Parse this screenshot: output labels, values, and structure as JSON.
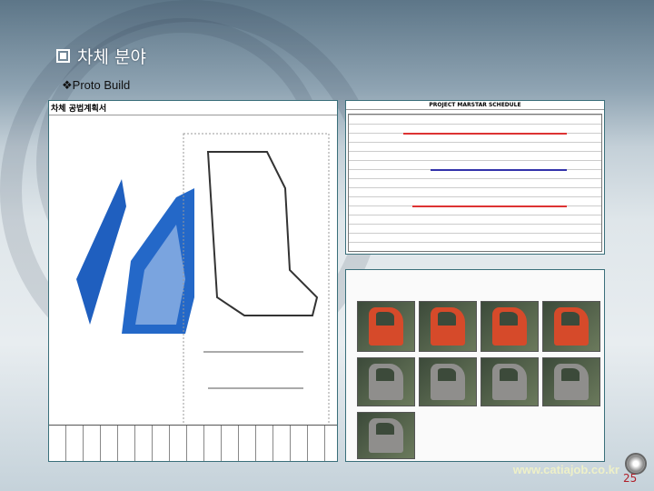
{
  "slide": {
    "title": "차체 분야",
    "subtitle": "❖Proto Build",
    "url": "www.catiajob.co.kr",
    "page_number": "25"
  },
  "left_doc": {
    "heading": "차체 공법계획서"
  },
  "schedule_doc": {
    "heading": "PROJECT MARSTAR SCHEDULE"
  }
}
